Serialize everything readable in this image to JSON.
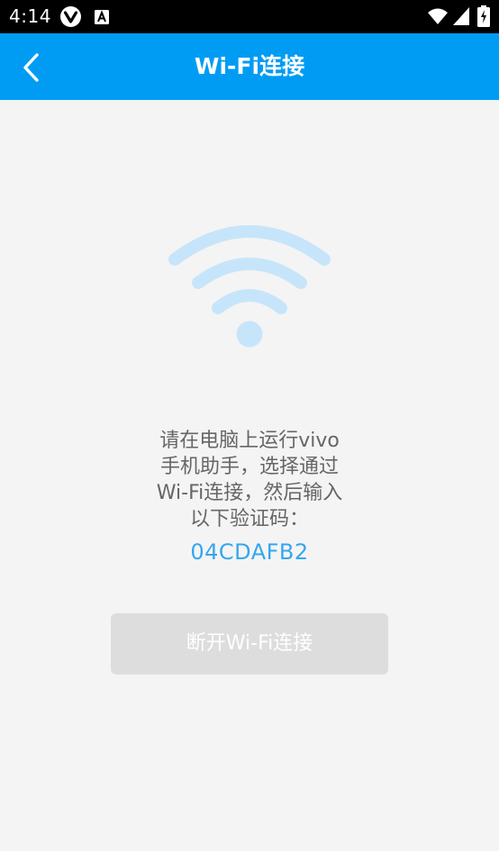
{
  "status_bar": {
    "time": "4:14",
    "icons": [
      "vivo-icon",
      "a-icon",
      "wifi-icon",
      "signal-icon",
      "battery-icon"
    ]
  },
  "app_bar": {
    "title": "Wi-Fi连接",
    "back_icon": "chevron-left-icon",
    "color": "#009cf3"
  },
  "main": {
    "graphic_icon": "wifi-icon",
    "graphic_color": "#c6e5fb",
    "instruction_lines": [
      "请在电脑上运行vivo",
      "手机助手，选择通过",
      "Wi-Fi连接，然后输入",
      "以下验证码："
    ],
    "verification_code": "04CDAFB2",
    "code_color": "#36a6ee",
    "disconnect_button_label": "断开Wi-Fi连接"
  }
}
